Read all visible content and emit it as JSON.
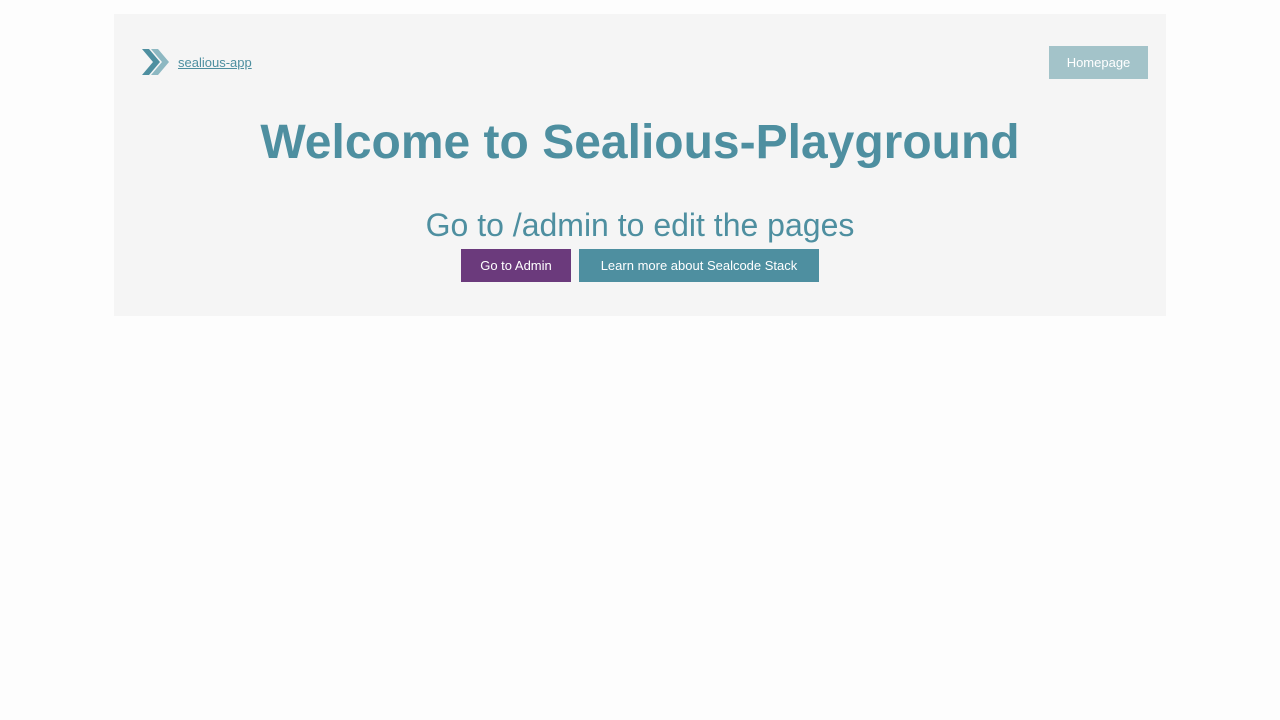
{
  "header": {
    "app_name": "sealious-app",
    "homepage_label": "Homepage"
  },
  "main": {
    "title": "Welcome to Sealious-Playground",
    "subtitle": "Go to /admin to edit the pages",
    "admin_button_label": "Go to Admin",
    "learn_button_label": "Learn more about Sealcode Stack"
  },
  "icons": {
    "logo": "double-chevron-logo-icon"
  },
  "colors": {
    "accent": "#4e8fa0",
    "admin_button": "#6b3a7c",
    "homepage_button": "#a3c3c9",
    "panel_background": "#f5f5f5"
  }
}
